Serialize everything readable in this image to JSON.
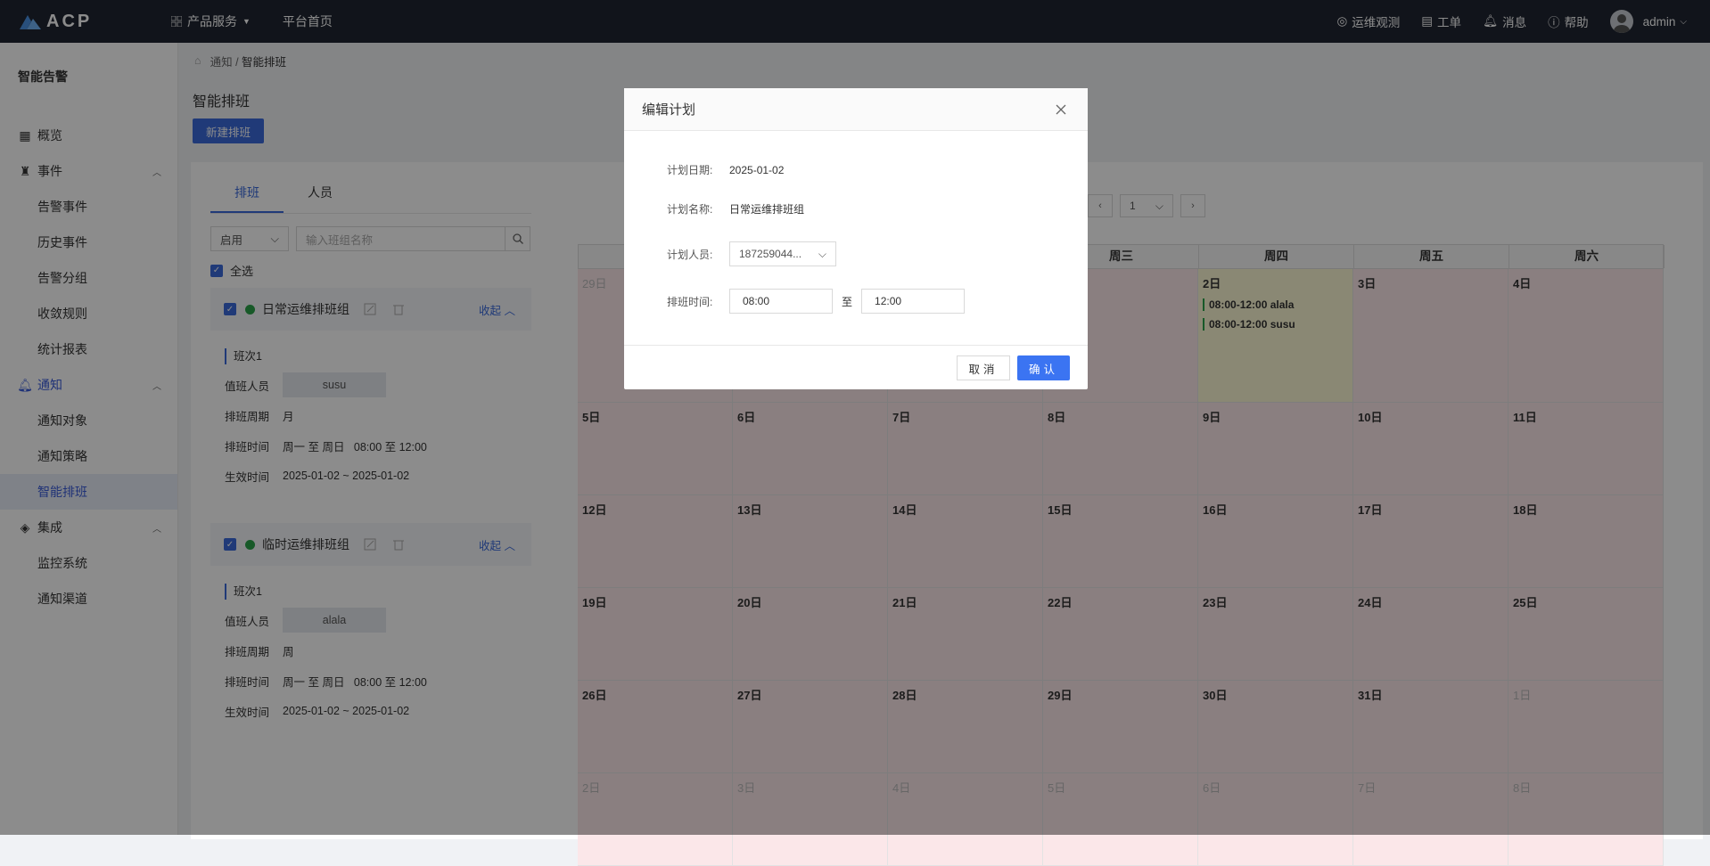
{
  "topbar": {
    "logo_text": "ACP",
    "nav": [
      {
        "label": "产品服务"
      },
      {
        "label": "平台首页"
      }
    ],
    "right": [
      {
        "label": "运维观测"
      },
      {
        "label": "工单"
      },
      {
        "label": "消息"
      },
      {
        "label": "帮助"
      }
    ],
    "user": "admin"
  },
  "sidebar": {
    "title": "智能告警",
    "overview": "概览",
    "events": {
      "label": "事件",
      "items": [
        "告警事件",
        "历史事件",
        "告警分组",
        "收敛规则",
        "统计报表"
      ]
    },
    "notify": {
      "label": "通知",
      "items": [
        "通知对象",
        "通知策略",
        "智能排班"
      ]
    },
    "integrate": {
      "label": "集成",
      "items": [
        "监控系统",
        "通知渠道"
      ]
    }
  },
  "breadcrumb": {
    "parent": "通知",
    "current": "智能排班",
    "sep": "/"
  },
  "page": {
    "title": "智能排班",
    "new_button": "新建排班"
  },
  "left_panel": {
    "tabs": [
      "排班",
      "人员"
    ],
    "filter_select": "启用",
    "search_placeholder": "输入班组名称",
    "select_all": "全选",
    "groups": [
      {
        "name": "日常运维排班组",
        "collapse": "收起",
        "shift_label": "班次1",
        "person_label": "值班人员",
        "person": "susu",
        "cycle_label": "排班周期",
        "cycle": "月",
        "time_label": "排班时间",
        "time": "周一 至 周日   08:00 至 12:00",
        "effective_label": "生效时间",
        "effective": "2025-01-02 ~ 2025-01-02"
      },
      {
        "name": "临时运维排班组",
        "collapse": "收起",
        "shift_label": "班次1",
        "person_label": "值班人员",
        "person": "alala",
        "cycle_label": "排班周期",
        "cycle": "周",
        "time_label": "排班时间",
        "time": "周一 至 周日   08:00 至 12:00",
        "effective_label": "生效时间",
        "effective": "2025-01-02 ~ 2025-01-02"
      }
    ]
  },
  "calendar": {
    "page_select": "1",
    "weekdays": [
      "",
      "",
      "",
      "周三",
      "周四",
      "周五",
      "周六"
    ],
    "weeks": [
      [
        {
          "d": "29日",
          "other": true
        },
        {
          "d": ""
        },
        {
          "d": ""
        },
        {
          "d": ""
        },
        {
          "d": "2日",
          "today": true,
          "events": [
            "08:00-12:00 alala",
            "08:00-12:00 susu"
          ]
        },
        {
          "d": "3日"
        },
        {
          "d": "4日"
        }
      ],
      [
        {
          "d": "5日"
        },
        {
          "d": "6日"
        },
        {
          "d": "7日"
        },
        {
          "d": "8日"
        },
        {
          "d": "9日"
        },
        {
          "d": "10日"
        },
        {
          "d": "11日"
        }
      ],
      [
        {
          "d": "12日"
        },
        {
          "d": "13日"
        },
        {
          "d": "14日"
        },
        {
          "d": "15日"
        },
        {
          "d": "16日"
        },
        {
          "d": "17日"
        },
        {
          "d": "18日"
        }
      ],
      [
        {
          "d": "19日"
        },
        {
          "d": "20日"
        },
        {
          "d": "21日"
        },
        {
          "d": "22日"
        },
        {
          "d": "23日"
        },
        {
          "d": "24日"
        },
        {
          "d": "25日"
        }
      ],
      [
        {
          "d": "26日"
        },
        {
          "d": "27日"
        },
        {
          "d": "28日"
        },
        {
          "d": "29日"
        },
        {
          "d": "30日"
        },
        {
          "d": "31日"
        },
        {
          "d": "1日",
          "other": true
        }
      ],
      [
        {
          "d": "2日",
          "other": true
        },
        {
          "d": "3日",
          "other": true
        },
        {
          "d": "4日",
          "other": true
        },
        {
          "d": "5日",
          "other": true
        },
        {
          "d": "6日",
          "other": true
        },
        {
          "d": "7日",
          "other": true
        },
        {
          "d": "8日",
          "other": true
        }
      ]
    ]
  },
  "dialog": {
    "title": "编辑计划",
    "date_label": "计划日期:",
    "date": "2025-01-02",
    "name_label": "计划名称:",
    "name": "日常运维排班组",
    "person_label": "计划人员:",
    "person": "187259044...",
    "time_label": "排班时间:",
    "start": "08:00",
    "to": "至",
    "end": "12:00",
    "cancel": "取消",
    "ok": "确认"
  }
}
